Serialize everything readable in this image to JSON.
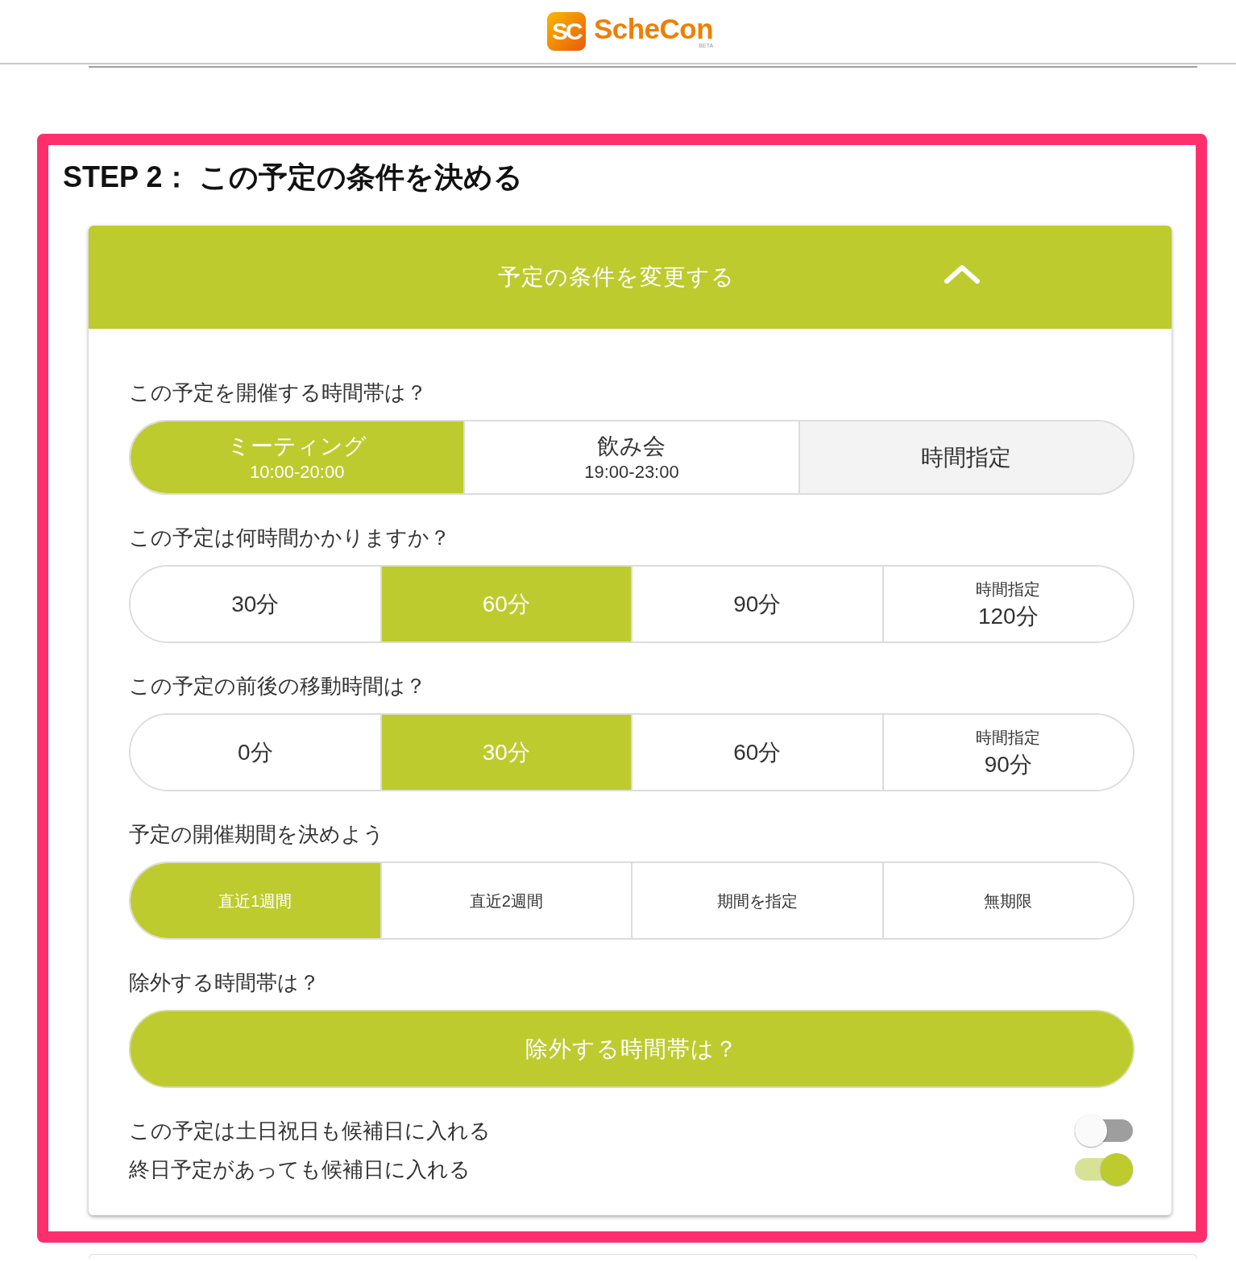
{
  "header": {
    "logo_mark": "SC",
    "logo_text": "ScheCon",
    "logo_badge": "BETA"
  },
  "step": {
    "title": "STEP 2： この予定の条件を決める"
  },
  "panel": {
    "title": "予定の条件を変更する",
    "expanded": true,
    "questions": [
      {
        "kind": "band",
        "label": "この予定を開催する時間帯は？",
        "options": [
          {
            "kind": "preset",
            "label": "ミーティング",
            "sublabel": "10:00-20:00",
            "selected": true
          },
          {
            "kind": "preset",
            "label": "飲み会",
            "sublabel": "19:00-23:00",
            "selected": false
          },
          {
            "kind": "custom",
            "label": "時間指定",
            "selected": false
          }
        ]
      },
      {
        "kind": "duration",
        "label": "この予定は何時間かかりますか？",
        "options": [
          {
            "kind": "preset",
            "label": "30分",
            "selected": false
          },
          {
            "kind": "preset",
            "label": "60分",
            "selected": true
          },
          {
            "kind": "preset",
            "label": "90分",
            "selected": false
          },
          {
            "kind": "specified",
            "caption": "時間指定",
            "label": "120分",
            "selected": false
          }
        ]
      },
      {
        "kind": "duration",
        "label": "この予定の前後の移動時間は？",
        "options": [
          {
            "kind": "preset",
            "label": "0分",
            "selected": false
          },
          {
            "kind": "preset",
            "label": "30分",
            "selected": true
          },
          {
            "kind": "preset",
            "label": "60分",
            "selected": false
          },
          {
            "kind": "specified",
            "caption": "時間指定",
            "label": "90分",
            "selected": false
          }
        ]
      },
      {
        "kind": "period",
        "label": "予定の開催期間を決めよう",
        "options": [
          {
            "kind": "preset",
            "label": "直近1週間",
            "selected": true
          },
          {
            "kind": "preset",
            "label": "直近2週間",
            "selected": false
          },
          {
            "kind": "preset",
            "label": "期間を指定",
            "selected": false
          },
          {
            "kind": "preset",
            "label": "無期限",
            "selected": false
          }
        ]
      },
      {
        "kind": "action",
        "label": "除外する時間帯は？",
        "button": "除外する時間帯は？"
      }
    ],
    "toggles": [
      {
        "label": "この予定は土日祝日も候補日に入れる",
        "on": false
      },
      {
        "label": "終日予定があっても候補日に入れる",
        "on": true
      }
    ]
  }
}
